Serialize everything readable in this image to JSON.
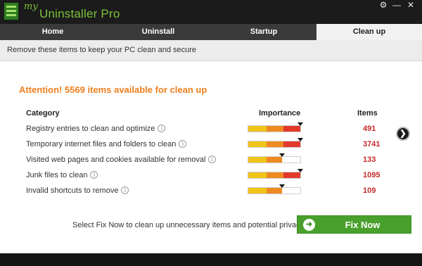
{
  "app": {
    "logo_my": "my",
    "logo_name": "Uninstaller Pro",
    "window_controls": [
      {
        "icon": "gear-icon",
        "glyph": "⚙"
      },
      {
        "icon": "minimize-icon",
        "glyph": "—"
      },
      {
        "icon": "close-icon",
        "glyph": "✕"
      }
    ]
  },
  "tabs": [
    {
      "label": "Home",
      "active": false
    },
    {
      "label": "Uninstall",
      "active": false
    },
    {
      "label": "Startup",
      "active": false
    },
    {
      "label": "Clean up",
      "active": true
    }
  ],
  "subheader": "Remove these items to keep your PC clean and secure",
  "attention": "Attention! 5569 items available for clean up",
  "columns": {
    "category": "Category",
    "importance": "Importance",
    "items": "Items"
  },
  "rows": [
    {
      "label": "Registry entries to clean and optimize",
      "count": "491",
      "importance_level": 1.0
    },
    {
      "label": "Temporary internet files and folders to clean",
      "count": "3741",
      "importance_level": 1.0
    },
    {
      "label": "Visited web pages and cookies available for removal",
      "count": "133",
      "importance_level": 0.65
    },
    {
      "label": "Junk files to clean",
      "count": "1095",
      "importance_level": 1.0
    },
    {
      "label": "Invalid shortcuts to remove",
      "count": "109",
      "importance_level": 0.65
    }
  ],
  "fix_prompt": "Select Fix Now to clean up unnecessary items and potential privacy risks",
  "fix_button": "Fix Now",
  "colors": {
    "accent": "#ee7f1e",
    "brand": "#7cc23a",
    "count": "#c62828",
    "button": "#4aa02c"
  }
}
